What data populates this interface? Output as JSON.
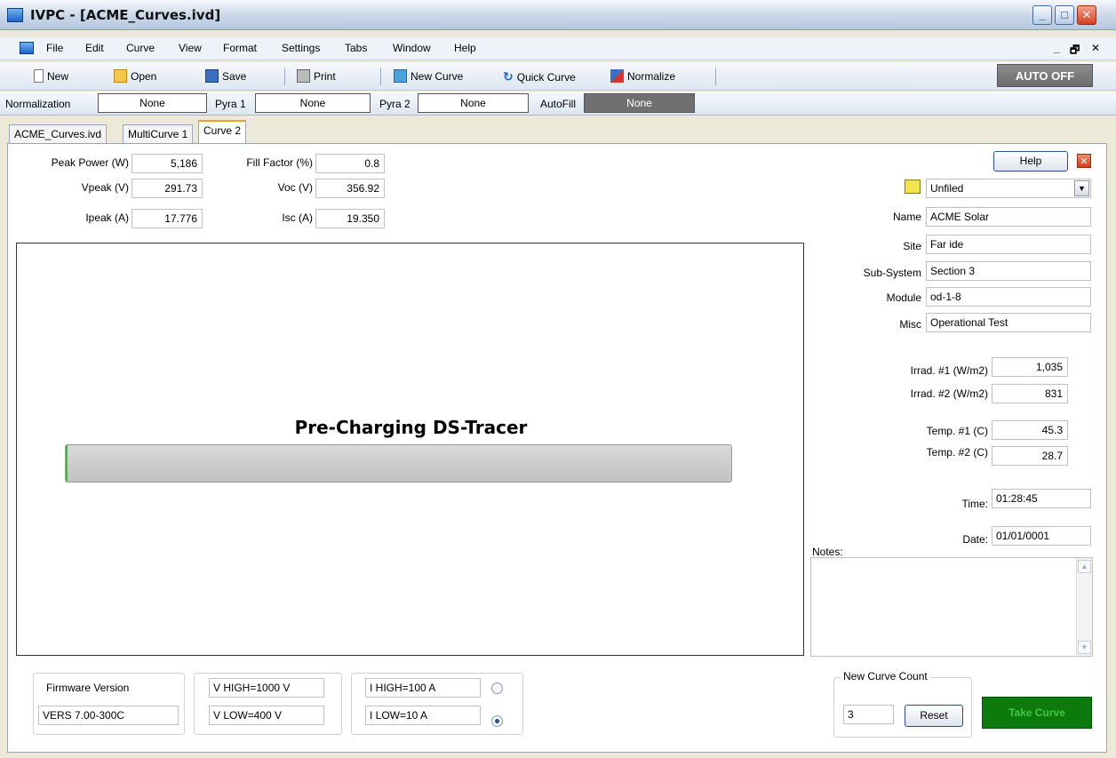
{
  "window": {
    "title": "IVPC - [ACME_Curves.ivd]"
  },
  "menu": [
    "File",
    "Edit",
    "Curve",
    "View",
    "Format",
    "Settings",
    "Tabs",
    "Window",
    "Help"
  ],
  "menu_right": {
    "minimize": "_",
    "restore": "🗗",
    "close": "✕"
  },
  "toolbar": {
    "new": "New",
    "open": "Open",
    "save": "Save",
    "print": "Print",
    "new_curve": "New Curve",
    "quick_curve": "Quick Curve",
    "normalize": "Normalize",
    "auto": "AUTO OFF"
  },
  "normbar": {
    "normalization_label": "Normalization",
    "normalization_value": "None",
    "pyra1_label": "Pyra 1",
    "pyra1_value": "None",
    "pyra2_label": "Pyra 2",
    "pyra2_value": "None",
    "autofill_label": "AutoFill",
    "autofill_value": "None"
  },
  "tabs": [
    "ACME_Curves.ivd",
    "MultiCurve 1",
    "Curve 2"
  ],
  "measurements": {
    "peak_power_label": "Peak Power (W)",
    "peak_power": "5,186",
    "vpeak_label": "Vpeak (V)",
    "vpeak": "291.73",
    "ipeak_label": "Ipeak (A)",
    "ipeak": "17.776",
    "fill_factor_label": "Fill Factor (%)",
    "fill_factor": "0.8",
    "voc_label": "Voc (V)",
    "voc": "356.92",
    "isc_label": "Isc (A)",
    "isc": "19.350"
  },
  "graph": {
    "message": "Pre-Charging DS-Tracer",
    "progress": 0.003
  },
  "side": {
    "help": "Help",
    "folder": "Unfiled",
    "name_label": "Name",
    "name": "ACME Solar",
    "site_label": "Site",
    "site": "Far ide",
    "subsystem_label": "Sub-System",
    "subsystem": "Section 3",
    "module_label": "Module",
    "module": "od-1-8",
    "misc_label": "Misc",
    "misc": "Operational Test",
    "irrad1_label": "Irrad. #1 (W/m2)",
    "irrad1": "1,035",
    "irrad2_label": "Irrad. #2 (W/m2)",
    "irrad2": "831",
    "temp1_label": "Temp. #1 (C)",
    "temp1": "45.3",
    "temp2_label": "Temp. #2 (C)",
    "temp2": "28.7",
    "time_label": "Time:",
    "time": "01:28:45",
    "date_label": "Date:",
    "date": "01/01/0001",
    "notes_label": "Notes:"
  },
  "bottom": {
    "firmware_label": "Firmware Version",
    "firmware": "VERS 7.00-300C",
    "v_high": "V HIGH=1000 V",
    "v_low": "V LOW=400 V",
    "i_high": "I HIGH=100 A",
    "i_low": "I LOW=10 A",
    "new_curve_count_label": "New Curve Count",
    "new_curve_count": "3",
    "reset": "Reset",
    "take_curve": "Take Curve"
  }
}
